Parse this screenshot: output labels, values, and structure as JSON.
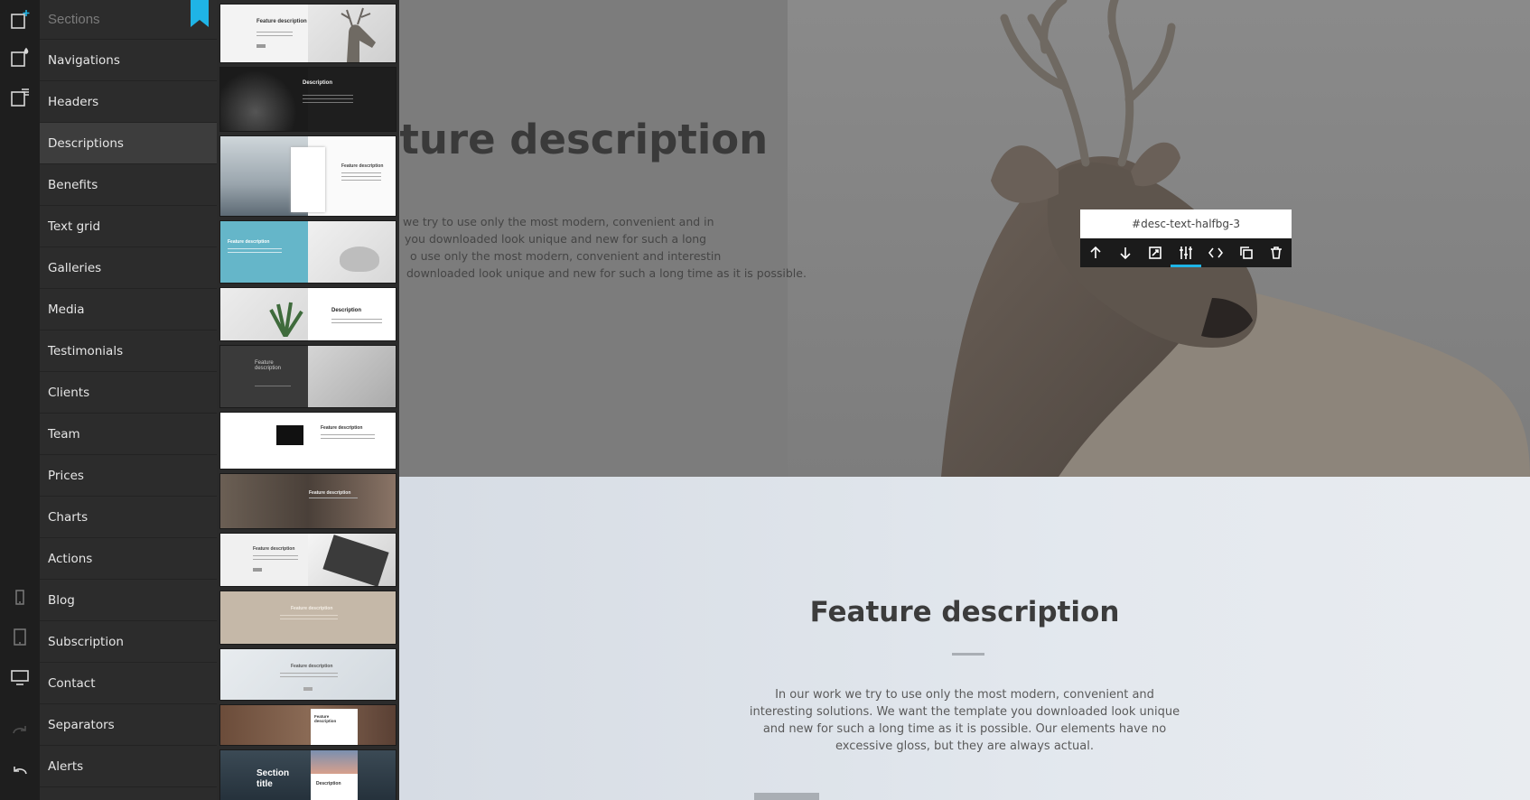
{
  "sidebar": {
    "title": "Sections",
    "items": [
      {
        "label": "Navigations",
        "active": false
      },
      {
        "label": "Headers",
        "active": false
      },
      {
        "label": "Descriptions",
        "active": true
      },
      {
        "label": "Benefits",
        "active": false
      },
      {
        "label": "Text grid",
        "active": false
      },
      {
        "label": "Galleries",
        "active": false
      },
      {
        "label": "Media",
        "active": false
      },
      {
        "label": "Testimonials",
        "active": false
      },
      {
        "label": "Clients",
        "active": false
      },
      {
        "label": "Team",
        "active": false
      },
      {
        "label": "Prices",
        "active": false
      },
      {
        "label": "Charts",
        "active": false
      },
      {
        "label": "Actions",
        "active": false
      },
      {
        "label": "Blog",
        "active": false
      },
      {
        "label": "Subscription",
        "active": false
      },
      {
        "label": "Contact",
        "active": false
      },
      {
        "label": "Separators",
        "active": false
      },
      {
        "label": "Alerts",
        "active": false
      }
    ]
  },
  "rail": {
    "top_icons": [
      "add-section-icon",
      "add-styled-section-icon",
      "section-list-icon"
    ],
    "bottom_icons": [
      "mobile-view-icon",
      "tablet-view-icon",
      "desktop-view-icon",
      "redo-icon",
      "undo-icon"
    ]
  },
  "thumbnails": [
    {
      "label": "Feature description",
      "style": "light-deer"
    },
    {
      "label": "Description",
      "style": "dark-bike"
    },
    {
      "label": "Feature description",
      "style": "hiker-card"
    },
    {
      "label": "Feature description",
      "style": "blue-speaker"
    },
    {
      "label": "Description",
      "style": "plant"
    },
    {
      "label": "Feature description",
      "style": "dark-fashion"
    },
    {
      "label": "Feature description",
      "style": "desk-monitor"
    },
    {
      "label": "Feature description",
      "style": "room-wood"
    },
    {
      "label": "Feature description",
      "style": "laptop"
    },
    {
      "label": "Feature description",
      "style": "beige"
    },
    {
      "label": "Feature description",
      "style": "light-center"
    },
    {
      "label": "Feature description",
      "style": "food-card"
    },
    {
      "label": "Section title",
      "sublabel": "Description",
      "style": "mountain"
    }
  ],
  "canvas": {
    "section1": {
      "title": "ature description",
      "text_lines": [
        "we try to use only the most modern, convenient and in",
        "you downloaded look unique and new for such a long",
        "o use only the most modern, convenient and interestin",
        "downloaded look unique and new for such a long time as it is possible."
      ]
    },
    "section2": {
      "title": "Feature description",
      "text": "In our work we try to use only the most modern, convenient and interesting solutions. We want the template you downloaded look unique and new for such a long time as it is possible. Our elements have no excessive gloss, but they are always actual."
    }
  },
  "toolbar": {
    "section_id": "#desc-text-halfbg-3",
    "buttons": [
      "move-up-icon",
      "move-down-icon",
      "crop-icon",
      "settings-icon",
      "code-icon",
      "duplicate-icon",
      "delete-icon"
    ],
    "active_button": "settings-icon"
  },
  "colors": {
    "accent": "#1fb4e6",
    "rail_bg": "#1e1e1e",
    "menu_bg": "#2c2c2c",
    "menu_active": "#3d3d3d"
  }
}
